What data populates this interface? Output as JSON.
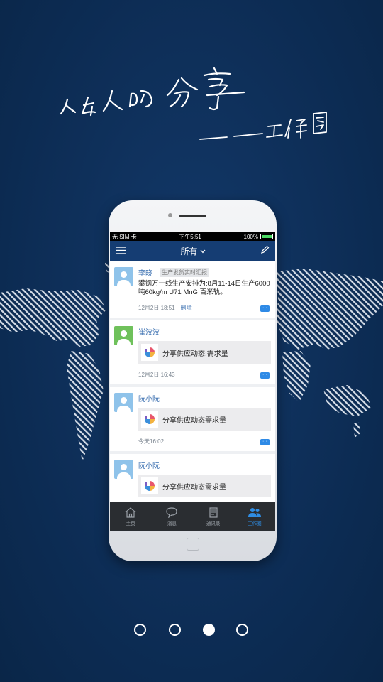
{
  "slogan": {
    "line1": "人与人的分享",
    "line2": "——工作圈"
  },
  "status_bar": {
    "carrier": "无 SIM 卡",
    "time": "下午5:51",
    "battery": "100%"
  },
  "nav": {
    "title": "所有",
    "menu_icon": "menu-icon",
    "edit_icon": "pencil-icon"
  },
  "posts": [
    {
      "author": "李晓",
      "tag": "生产发货实时汇报",
      "content": "攀钢万一线生产安排为:8月11-14日生产6000吨60kg/m U71 MnG 百米轨。",
      "time": "12月2日 18:51",
      "delete": "删除"
    },
    {
      "author": "崔波波",
      "share": "分享供应动态:需求量",
      "time": "12月2日 16:43"
    },
    {
      "author": "阮小阮",
      "share": "分享供应动态需求量",
      "time": "今天16:02"
    },
    {
      "author": "阮小阮",
      "share": "分享供应动态需求量"
    }
  ],
  "tabbar": [
    {
      "label": "主页",
      "icon": "home-icon",
      "active": false
    },
    {
      "label": "消息",
      "icon": "chat-icon",
      "active": false
    },
    {
      "label": "通讯录",
      "icon": "contacts-icon",
      "active": false
    },
    {
      "label": "工作圈",
      "icon": "people-icon",
      "active": true
    }
  ],
  "pagination": {
    "count": 4,
    "active_index": 2
  },
  "colors": {
    "background": "#0e2f57",
    "navbar": "#153d73",
    "accent": "#2f8de4"
  }
}
